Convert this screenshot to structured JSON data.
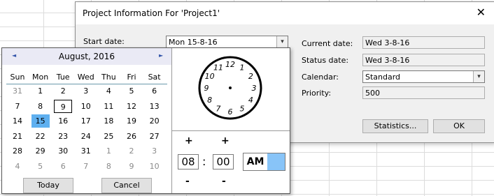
{
  "dialog": {
    "title": "Project Information For 'Project1'",
    "start_date_label": "Start date:",
    "start_date_value": "Mon 15-8-16",
    "current_date_label": "Current date:",
    "current_date_value": "Wed 3-8-16",
    "status_date_label": "Status date:",
    "status_date_value": "Wed 3-8-16",
    "calendar_label": "Calendar:",
    "calendar_value": "Standard",
    "priority_label": "Priority:",
    "priority_value": "500",
    "statistics_label": "Statistics...",
    "ok_label": "OK",
    "close_glyph": "✕",
    "dropdown_glyph": "▾"
  },
  "calendar": {
    "month_label": "August, 2016",
    "prev_glyph": "◄",
    "next_glyph": "►",
    "weekdays": [
      "Sun",
      "Mon",
      "Tue",
      "Wed",
      "Thu",
      "Fri",
      "Sat"
    ],
    "weeks": [
      [
        {
          "d": "31",
          "other": true
        },
        {
          "d": "1"
        },
        {
          "d": "2"
        },
        {
          "d": "3"
        },
        {
          "d": "4"
        },
        {
          "d": "5"
        },
        {
          "d": "6"
        }
      ],
      [
        {
          "d": "7"
        },
        {
          "d": "8"
        },
        {
          "d": "9",
          "today": true
        },
        {
          "d": "10"
        },
        {
          "d": "11"
        },
        {
          "d": "12"
        },
        {
          "d": "13"
        }
      ],
      [
        {
          "d": "14"
        },
        {
          "d": "15",
          "selected": true
        },
        {
          "d": "16"
        },
        {
          "d": "17"
        },
        {
          "d": "18"
        },
        {
          "d": "19"
        },
        {
          "d": "20"
        }
      ],
      [
        {
          "d": "21"
        },
        {
          "d": "22"
        },
        {
          "d": "23"
        },
        {
          "d": "24"
        },
        {
          "d": "25"
        },
        {
          "d": "26"
        },
        {
          "d": "27"
        }
      ],
      [
        {
          "d": "28"
        },
        {
          "d": "29"
        },
        {
          "d": "30"
        },
        {
          "d": "31"
        },
        {
          "d": "1",
          "other": true
        },
        {
          "d": "2",
          "other": true
        },
        {
          "d": "3",
          "other": true
        }
      ],
      [
        {
          "d": "4",
          "other": true
        },
        {
          "d": "5",
          "other": true
        },
        {
          "d": "6",
          "other": true
        },
        {
          "d": "7",
          "other": true
        },
        {
          "d": "8",
          "other": true
        },
        {
          "d": "9",
          "other": true
        },
        {
          "d": "10",
          "other": true
        }
      ]
    ],
    "today_button": "Today",
    "cancel_button": "Cancel",
    "selected_color": "#5fb0f0"
  },
  "time": {
    "clock_numbers": [
      "12",
      "1",
      "2",
      "3",
      "4",
      "5",
      "6",
      "7",
      "8",
      "9",
      "10",
      "11"
    ],
    "hour": "08",
    "minute": "00",
    "separator": ":",
    "ampm": "AM",
    "plus": "+",
    "minus": "-",
    "pm_indicator_color": "#88c4f8"
  }
}
